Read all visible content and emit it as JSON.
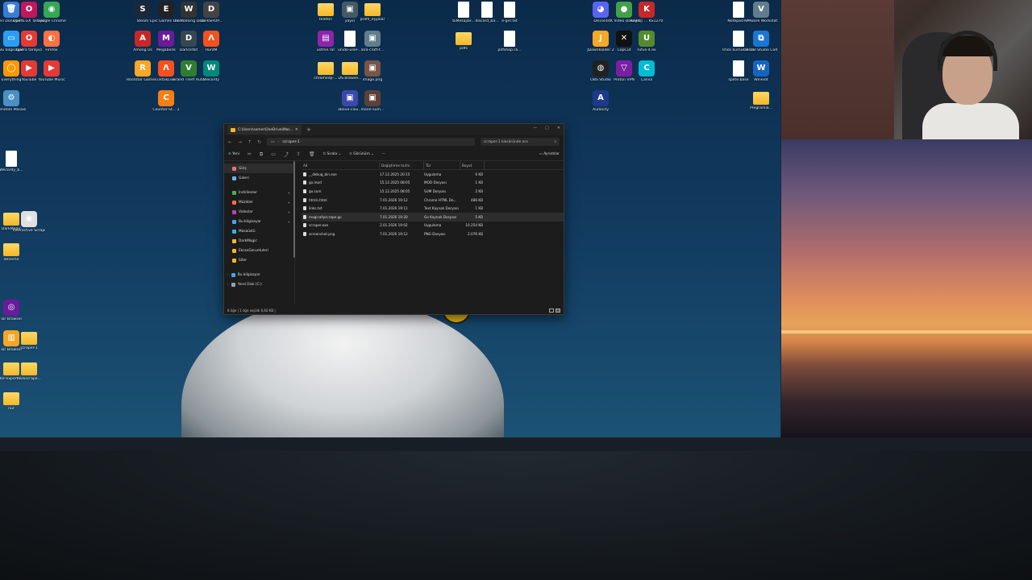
{
  "desktop": {
    "icons": [
      {
        "label": "Geri Dönüşüm...",
        "kind": "app",
        "color": "#3a7bd5",
        "glyph": "🗑"
      },
      {
        "label": "Opera GX Tarayıcı",
        "kind": "app",
        "color": "#c2185b",
        "glyph": "O"
      },
      {
        "label": "Google Chrome",
        "kind": "app",
        "color": "#34a853",
        "glyph": "◉"
      },
      {
        "label": "Bu bilgisayar",
        "kind": "app",
        "color": "#2a9df4",
        "glyph": "▭"
      },
      {
        "label": "Opera tarayıcı",
        "kind": "app",
        "color": "#e53935",
        "glyph": "O"
      },
      {
        "label": "Firefox",
        "kind": "app",
        "color": "#ff7043",
        "glyph": "◐"
      },
      {
        "label": "Everything",
        "kind": "app",
        "color": "#ff9800",
        "glyph": "◯"
      },
      {
        "label": "YouTube",
        "kind": "app",
        "color": "#e53935",
        "glyph": "▶"
      },
      {
        "label": "YouTube Music",
        "kind": "app",
        "color": "#e53935",
        "glyph": "▶"
      },
      {
        "label": "Denetim Masası",
        "kind": "app",
        "color": "#4a90c2",
        "glyph": "⚙"
      },
      {
        "label": "Steam",
        "kind": "app",
        "color": "#1b2838",
        "glyph": "S"
      },
      {
        "label": "Epic Games Launcher",
        "kind": "app",
        "color": "#222",
        "glyph": "E"
      },
      {
        "label": "The Walking Dead The ...",
        "kind": "app",
        "color": "#333",
        "glyph": "W"
      },
      {
        "label": "DarkSHOP...",
        "kind": "app",
        "color": "#444",
        "glyph": "D"
      },
      {
        "label": "Among Us",
        "kind": "app",
        "color": "#c62828",
        "glyph": "A"
      },
      {
        "label": "Megabonk",
        "kind": "app",
        "color": "#6a1b9a",
        "glyph": "M"
      },
      {
        "label": "DarkOrbit",
        "kind": "app",
        "color": "#37474f",
        "glyph": "D"
      },
      {
        "label": "HuntM",
        "kind": "app",
        "color": "#f4511e",
        "glyph": "Λ"
      },
      {
        "label": "Rockstar Games ...",
        "kind": "app",
        "color": "#f9a825",
        "glyph": "R"
      },
      {
        "label": "TiktokLive",
        "kind": "app",
        "color": "#f4511e",
        "glyph": "Λ"
      },
      {
        "label": "Grand Theft Auto V ...",
        "kind": "app",
        "color": "#2e7d32",
        "glyph": "V"
      },
      {
        "label": "Wecordy",
        "kind": "app",
        "color": "#00897b",
        "glyph": "W"
      },
      {
        "label": "Counter-St... 2",
        "kind": "app",
        "color": "#f57f17",
        "glyph": "C"
      },
      {
        "label": "telefon",
        "kind": "folder"
      },
      {
        "label": "yayın",
        "kind": "app",
        "color": "#455a64",
        "glyph": "▣"
      },
      {
        "label": "profil_eşyalar",
        "kind": "folder"
      },
      {
        "label": "üstme.rar",
        "kind": "app",
        "color": "#8e24aa",
        "glyph": "▤"
      },
      {
        "label": "unido-üsel-...",
        "kind": "doc"
      },
      {
        "label": "lara-croft-t...",
        "kind": "app",
        "color": "#607d8b",
        "glyph": "▣"
      },
      {
        "label": "chromedp-...",
        "kind": "folder"
      },
      {
        "label": "DS.Browse...",
        "kind": "folder"
      },
      {
        "label": "image.png",
        "kind": "app",
        "color": "#795548",
        "glyph": "▣"
      },
      {
        "label": "above-clou...",
        "kind": "app",
        "color": "#3949ab",
        "glyph": "▣"
      },
      {
        "label": "moon-sum...",
        "kind": "app",
        "color": "#5d4037",
        "glyph": "▣"
      },
      {
        "label": "bıMesajlar...",
        "kind": "doc"
      },
      {
        "label": "discord_ba...",
        "kind": "doc"
      },
      {
        "label": "e-girl.txt",
        "kind": "doc"
      },
      {
        "label": "pdfs",
        "kind": "folder"
      },
      {
        "label": "pdfshop.ra...",
        "kind": "doc"
      },
      {
        "label": "Discord",
        "kind": "app",
        "color": "#5865f2",
        "glyph": "◕"
      },
      {
        "label": "4K Video Downloader",
        "kind": "app",
        "color": "#43a047",
        "glyph": "●"
      },
      {
        "label": "Kayıtçı ... KS1270...",
        "kind": "app",
        "color": "#c62828",
        "glyph": "K"
      },
      {
        "label": "JDownloader 2",
        "kind": "app",
        "color": "#f9a825",
        "glyph": "J"
      },
      {
        "label": "CapCut",
        "kind": "app",
        "color": "#111",
        "glyph": "✕"
      },
      {
        "label": "rufus-4.ex",
        "kind": "app",
        "color": "#558b2f",
        "glyph": "U"
      },
      {
        "label": "OBS Studio",
        "kind": "app",
        "color": "#212121",
        "glyph": "◍"
      },
      {
        "label": "Proton VPN",
        "kind": "app",
        "color": "#7b1fa2",
        "glyph": "▽"
      },
      {
        "label": "Canva",
        "kind": "app",
        "color": "#00bcd4",
        "glyph": "C"
      },
      {
        "label": "Audacity",
        "kind": "app",
        "color": "#1e3a8a",
        "glyph": "A"
      },
      {
        "label": "Notepad++",
        "kind": "doc"
      },
      {
        "label": "VMware Workstati...",
        "kind": "app",
        "color": "#607d8b",
        "glyph": "V"
      },
      {
        "label": "Imos kurnuklaste...",
        "kind": "doc"
      },
      {
        "label": "Visual Studio Code",
        "kind": "app",
        "color": "#1976d2",
        "glyph": "⧉"
      },
      {
        "label": "spilte.base",
        "kind": "doc"
      },
      {
        "label": "Winedit",
        "kind": "app",
        "color": "#1565c0",
        "glyph": "W"
      },
      {
        "label": "Programla...",
        "kind": "folder"
      },
      {
        "label": "Wecordy_b...",
        "kind": "doc"
      },
      {
        "label": "DarkMagic",
        "kind": "folder"
      },
      {
        "label": "Interactive Scraper.pdf",
        "kind": "app",
        "color": "#e0e0e0",
        "glyph": "◉"
      },
      {
        "label": "deneme",
        "kind": "folder"
      },
      {
        "label": "Tor Browser",
        "kind": "app",
        "color": "#6a1b9a",
        "glyph": "◎"
      },
      {
        "label": "Tor Browser",
        "kind": "app",
        "color": "#f5a623",
        "glyph": "▥"
      },
      {
        "label": "scraper-1",
        "kind": "folder"
      },
      {
        "label": "tor-expert-...",
        "kind": "folder"
      },
      {
        "label": "darkscrape...",
        "kind": "folder"
      },
      {
        "label": "nur",
        "kind": "folder"
      }
    ]
  },
  "explorer": {
    "tab_title": "C:\\Users\\semer\\OneDrive\\Mas...",
    "tab_close": "✕",
    "new_tab": "+",
    "window_controls": [
      "—",
      "▢",
      "✕"
    ],
    "nav": {
      "back": "←",
      "forward": "→",
      "up": "↑",
      "refresh": "↻"
    },
    "path_sep": "›",
    "path": "scraper-1",
    "search_placeholder": "scraper-1 klasöründe ara",
    "search_icon": "⌕",
    "commands": {
      "new": "Yeni",
      "sort": "Sırala",
      "view": "Görünüm",
      "more": "···",
      "details": "Ayrıntılar"
    },
    "command_icons": [
      "✂",
      "⧉",
      "▭",
      "⤴",
      "⇪",
      "🗑"
    ],
    "sidebar": [
      {
        "label": "Giriş",
        "color": "#e57373",
        "selected": true
      },
      {
        "label": "Galeri",
        "color": "#64b5f6",
        "selected": false
      },
      {
        "sep": true
      },
      {
        "label": "İndirilenler",
        "color": "#4caf50",
        "pin": "📌"
      },
      {
        "label": "Müzikler",
        "color": "#ff7043",
        "pin": "📌"
      },
      {
        "label": "Videolar",
        "color": "#ab47bc",
        "pin": "📌"
      },
      {
        "label": "Bu bilgisayar",
        "color": "#42a5f5",
        "pin": "📌"
      },
      {
        "label": "Masaüstü",
        "color": "#29b6f6"
      },
      {
        "label": "DarkMagic",
        "color": "#f2b827"
      },
      {
        "label": "EkranGoruntuleri",
        "color": "#f2b827"
      },
      {
        "label": "Siter",
        "color": "#f2b827"
      },
      {
        "sep": true
      },
      {
        "label": "Bu bilgisayar",
        "color": "#42a5f5",
        "expander": "›"
      },
      {
        "label": "Yerel Disk (C:)",
        "color": "#90a4ae",
        "expander": "›"
      }
    ],
    "columns": [
      "Ad",
      "Değiştirme tarihi",
      "Tür",
      "Boyut"
    ],
    "files": [
      {
        "name": "__debug_bin.exe",
        "date": "17.12.2025 20:15",
        "type": "Uygulama",
        "size": "0 KB",
        "selected": false
      },
      {
        "name": "go.mod",
        "date": "15.12.2025 08:05",
        "type": "MOD Dosyası",
        "size": "1 KB",
        "selected": false
      },
      {
        "name": "go.sum",
        "date": "15.12.2025 08:05",
        "type": "SUM Dosyası",
        "size": "2 KB",
        "selected": false
      },
      {
        "name": "htmls.html",
        "date": "7.01.2026 19:12",
        "type": "Chrome HTML Do...",
        "size": "486 KB",
        "selected": false
      },
      {
        "name": "links.txt",
        "date": "7.01.2026 19:11",
        "type": "Text Kaynak Dosyası",
        "size": "1 KB",
        "selected": false
      },
      {
        "name": "magicallyscrape.go",
        "date": "7.01.2026 19:20",
        "type": "Go Kaynak Dosyası",
        "size": "5 KB",
        "selected": true
      },
      {
        "name": "scraper.exe",
        "date": "2.01.2026 19:02",
        "type": "Uygulama",
        "size": "10.254 KB",
        "selected": false
      },
      {
        "name": "screenshot.png",
        "date": "7.01.2026 19:12",
        "type": "PNG Dosyası",
        "size": "2.076 KB",
        "selected": false
      }
    ],
    "status": "8 öğe  |  1 öğe seçildi  6,60 KB  |"
  }
}
